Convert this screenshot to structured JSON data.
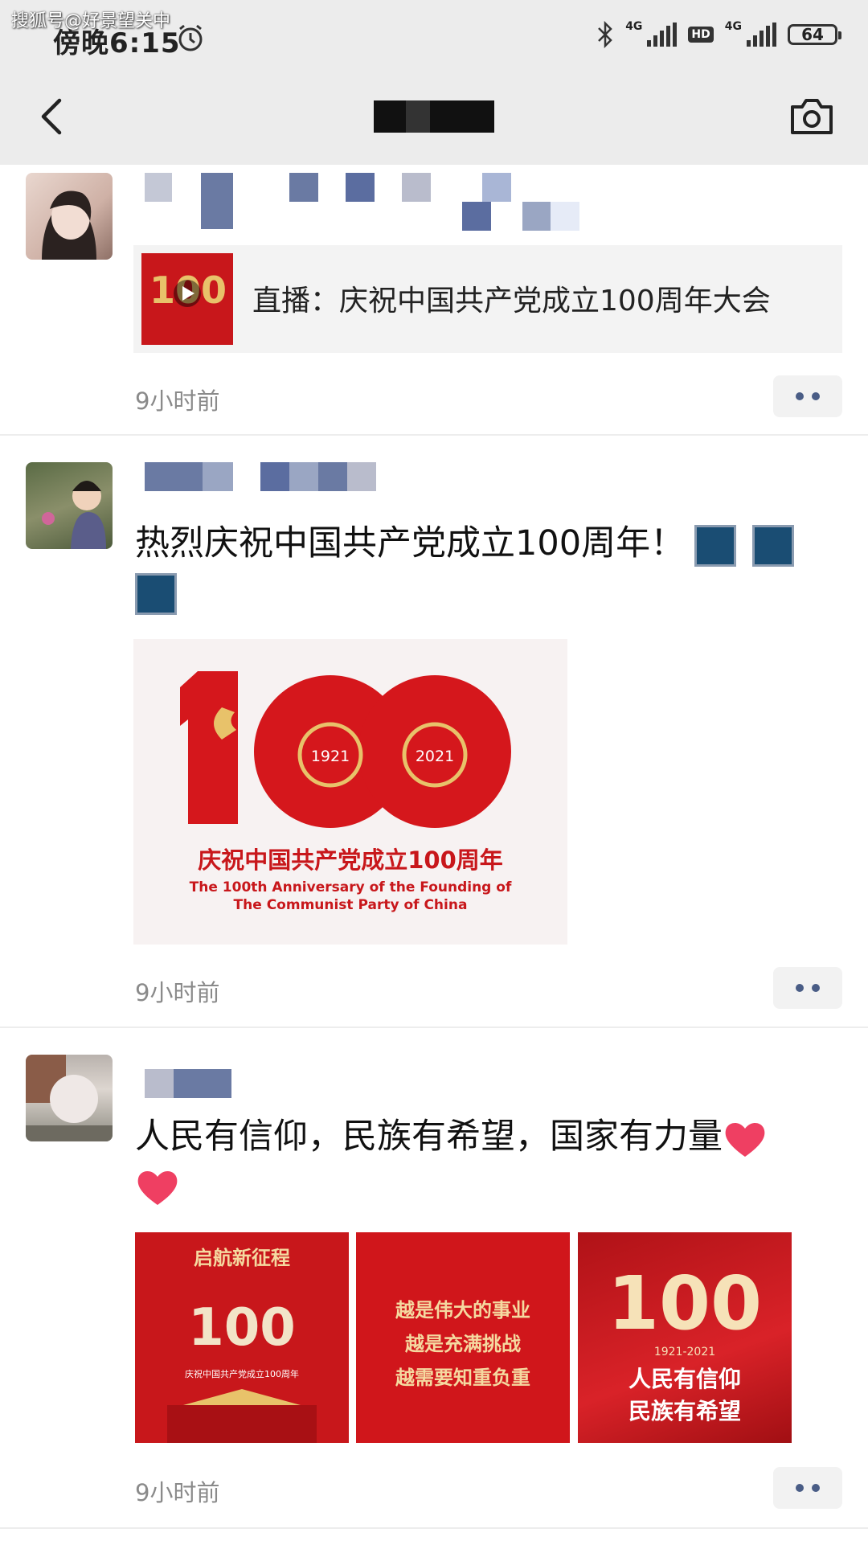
{
  "watermark": "搜狐号@好景望关中",
  "status_bar": {
    "time": "傍晚6:15",
    "network_1": "4G",
    "hd_badge": "HD",
    "network_2": "4G",
    "battery": "64"
  },
  "nav": {
    "back_icon": "chevron-left-icon",
    "camera_icon": "camera-icon"
  },
  "posts": [
    {
      "share_card": {
        "title": "直播：庆祝中国共产党成立100周年大会"
      },
      "time": "9小时前"
    },
    {
      "text": "热烈庆祝中国共产党成立100周年！",
      "emojis": [
        "fireworks-emoji",
        "fireworks-emoji",
        "fireworks-emoji"
      ],
      "image": {
        "years": [
          "1921",
          "2021"
        ],
        "caption_cn": "庆祝中国共产党成立100周年",
        "caption_en_1": "The 100th Anniversary of the Founding of",
        "caption_en_2": "The Communist Party of China"
      },
      "time": "9小时前"
    },
    {
      "text": "人民有信仰，民族有希望，国家有力量",
      "emojis": [
        "heart-emoji",
        "heart-emoji"
      ],
      "images": [
        {
          "line1": "启航新征程",
          "caption": "庆祝中国共产党成立100周年"
        },
        {
          "lines": [
            "越是伟大的事业",
            "越是充满挑战",
            "越需要知重负重"
          ]
        },
        {
          "big": "100",
          "years": "1921-2021",
          "line1": "人民有信仰",
          "line2": "民族有希望"
        }
      ],
      "time": "9小时前"
    }
  ],
  "colors": {
    "party_red": "#c8171b",
    "gold": "#e8c26a",
    "more_dot": "#4a5d86"
  }
}
